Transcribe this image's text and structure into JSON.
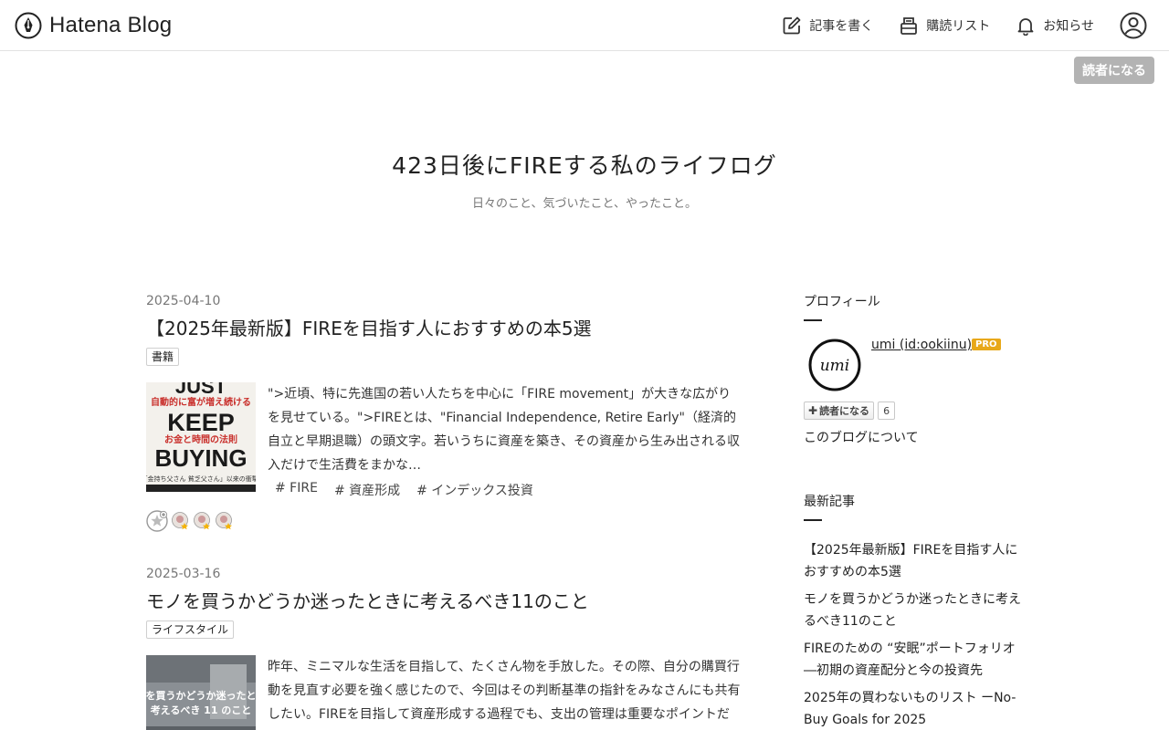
{
  "header": {
    "logo_text": "Hatena Blog",
    "nav": {
      "write": "記事を書く",
      "subscriptions": "購読リスト",
      "notifications": "お知らせ"
    },
    "subscribe_button": "読者になる"
  },
  "blog": {
    "title": "423日後にFIREする私のライフログ",
    "description": "日々のこと、気づいたこと、やったこと。"
  },
  "entries": [
    {
      "date": "2025-04-10",
      "title": "【2025年最新版】FIREを目指す人におすすめの本5選",
      "category": "書籍",
      "thumb_text": {
        "line1": "JUST",
        "line2": "自動的に富が増え続ける",
        "line3": "KEEP",
        "line4": "お金と時間の法則",
        "line5": "BUYING",
        "line6": "「金持ち父さん 貧乏父さん」以来の衝撃!"
      },
      "summary": "\">近頃、特に先進国の若い人たちを中心に「FIRE movement」が大きな広がりを見せている。\">FIREとは、\"Financial Independence, Retire Early\"（経済的自立と早期退職）の頭文字。若いうちに資産を築き、その資産から生み出される収入だけで生活費をまかな…",
      "tags": [
        "# FIRE",
        "# 資産形成",
        "# インデックス投資"
      ]
    },
    {
      "date": "2025-03-16",
      "title": "モノを買うかどうか迷ったときに考えるべき11のこと",
      "category": "ライフスタイル",
      "thumb_text": {
        "line1": "を買うかどうか迷ったと",
        "line2": "考えるべき 11 のこと"
      },
      "summary": "昨年、ミニマルな生活を目指して、たくさん物を手放した。その際、自分の購買行動を見直す必要を強く感じたので、今回はその判断基準の指針をみなさんにも共有したい。FIREを目指して資産形成する過程でも、支出の管理は重要なポイントだし、FIRE後も、限…"
    }
  ],
  "sidebar": {
    "profile_title": "プロフィール",
    "profile_name": "umi (id:ookiinu)",
    "profile_icon_text": "umi",
    "pro_badge": "PRO",
    "subscribe_label": "読者になる",
    "subscriber_count": "6",
    "about_link": "このブログについて",
    "recent_title": "最新記事",
    "recent_items": [
      "【2025年最新版】FIREを目指す人におすすめの本5選",
      "モノを買うかどうか迷ったときに考えるべき11のこと",
      "FIREのための “安眠”ポートフォリオ ―初期の資産配分と今の投資先",
      "2025年の買わないものリスト ーNo-Buy Goals for 2025"
    ]
  },
  "colors": {
    "pro_badge": "#e8a819",
    "subscribe_top": "#b3b3b3",
    "star_yellow": "#f5b301"
  }
}
